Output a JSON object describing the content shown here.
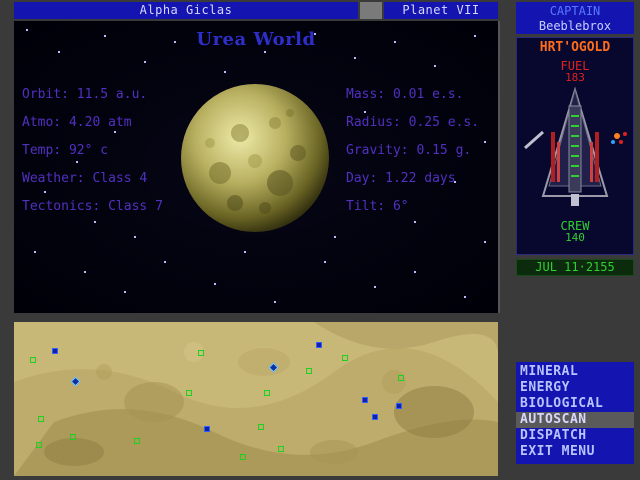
{
  "header": {
    "system_name": "Alpha Giclas",
    "planet_label": "Planet VII"
  },
  "planet": {
    "name": "Urea World",
    "stats_left": [
      {
        "label": "Orbit:",
        "value": "11.5 a.u."
      },
      {
        "label": "Atmo:",
        "value": "4.20 atm"
      },
      {
        "label": "Temp:",
        "value": "92° c"
      },
      {
        "label": "Weather:",
        "value": "Class 4"
      },
      {
        "label": "Tectonics:",
        "value": "Class 7"
      }
    ],
    "stats_right": [
      {
        "label": "Mass:",
        "value": "0.01 e.s."
      },
      {
        "label": "Radius:",
        "value": "0.25 e.s."
      },
      {
        "label": "Gravity:",
        "value": "0.15 g."
      },
      {
        "label": "Day:",
        "value": "1.22 days"
      },
      {
        "label": "Tilt:",
        "value": "6°"
      }
    ]
  },
  "captain": {
    "label": "CAPTAIN",
    "name": "Beeblebrox"
  },
  "ship": {
    "name": "HRT'OGOLD",
    "fuel_label": "FUEL",
    "fuel_value": "183",
    "crew_label": "CREW",
    "crew_value": "140"
  },
  "date": "JUL 11·2155",
  "menu": {
    "items": [
      {
        "label": "MINERAL"
      },
      {
        "label": "ENERGY"
      },
      {
        "label": "BIOLOGICAL"
      },
      {
        "label": "AUTOSCAN"
      },
      {
        "label": "DISPATCH"
      },
      {
        "label": "EXIT MENU"
      }
    ],
    "active_index": 3
  },
  "colors": {
    "header_bg": "#1414b0",
    "stat_text": "#5230c0",
    "surface": "#c8b878",
    "ship_name": "#ff6c1c",
    "fuel": "#e02020",
    "crew": "#30d030"
  }
}
